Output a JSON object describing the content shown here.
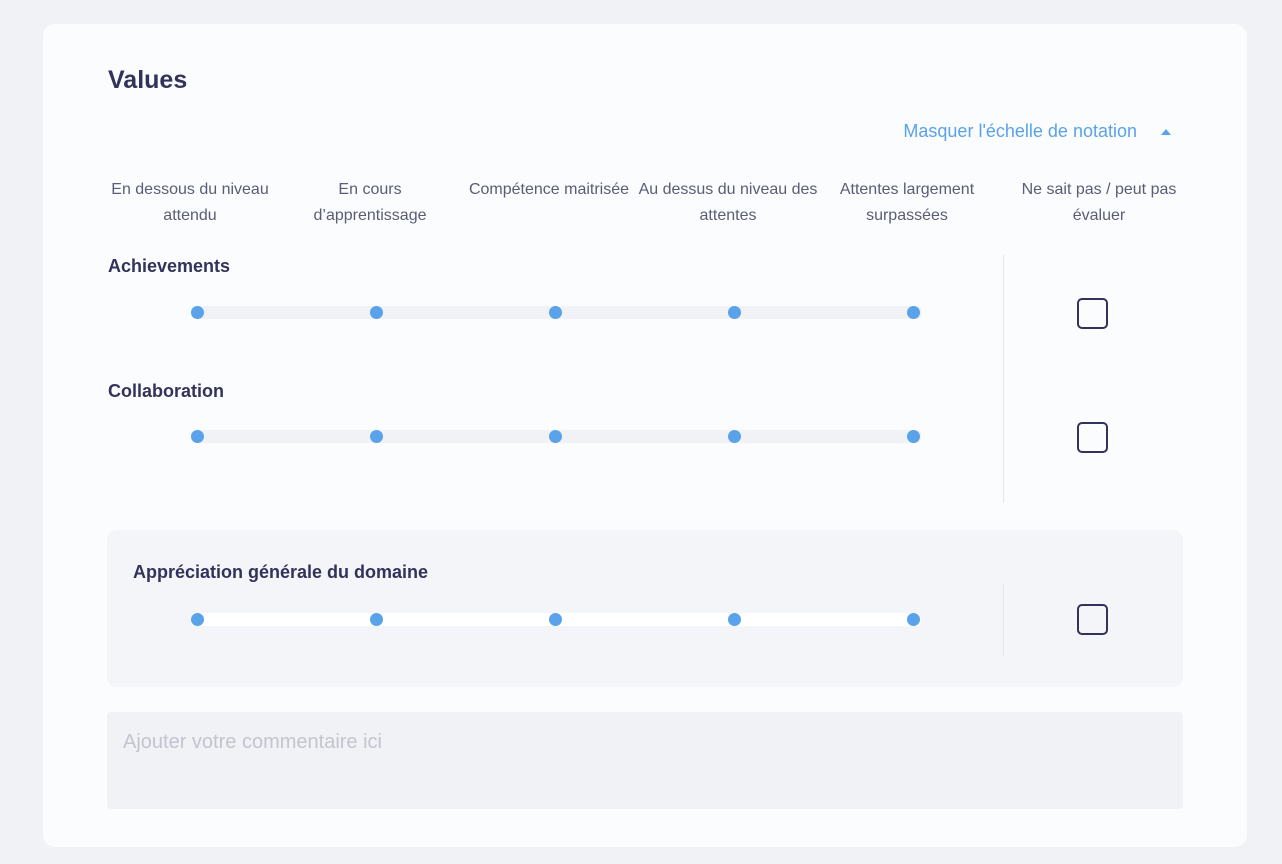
{
  "section": {
    "title": "Values"
  },
  "scale_toggle": {
    "label": "Masquer l'échelle de notation",
    "icon": "caret-up-icon"
  },
  "scale_headers": [
    "En dessous du niveau attendu",
    "En cours d’apprentissage",
    "Compétence maitrisée",
    "Au dessus du niveau des attentes",
    "Attentes largement surpassées",
    "Ne sait pas / peut pas évaluer"
  ],
  "criteria": [
    {
      "label": "Achievements",
      "cannot_evaluate_checked": false
    },
    {
      "label": "Collaboration",
      "cannot_evaluate_checked": false
    }
  ],
  "overall": {
    "label": "Appréciation générale du domaine",
    "cannot_evaluate_checked": false
  },
  "comment": {
    "placeholder": "Ajouter votre commentaire ici",
    "value": ""
  },
  "colors": {
    "accent": "#5aa2ea",
    "text": "#33325a",
    "background": "#f1f2f6",
    "card": "#fbfcfd"
  }
}
